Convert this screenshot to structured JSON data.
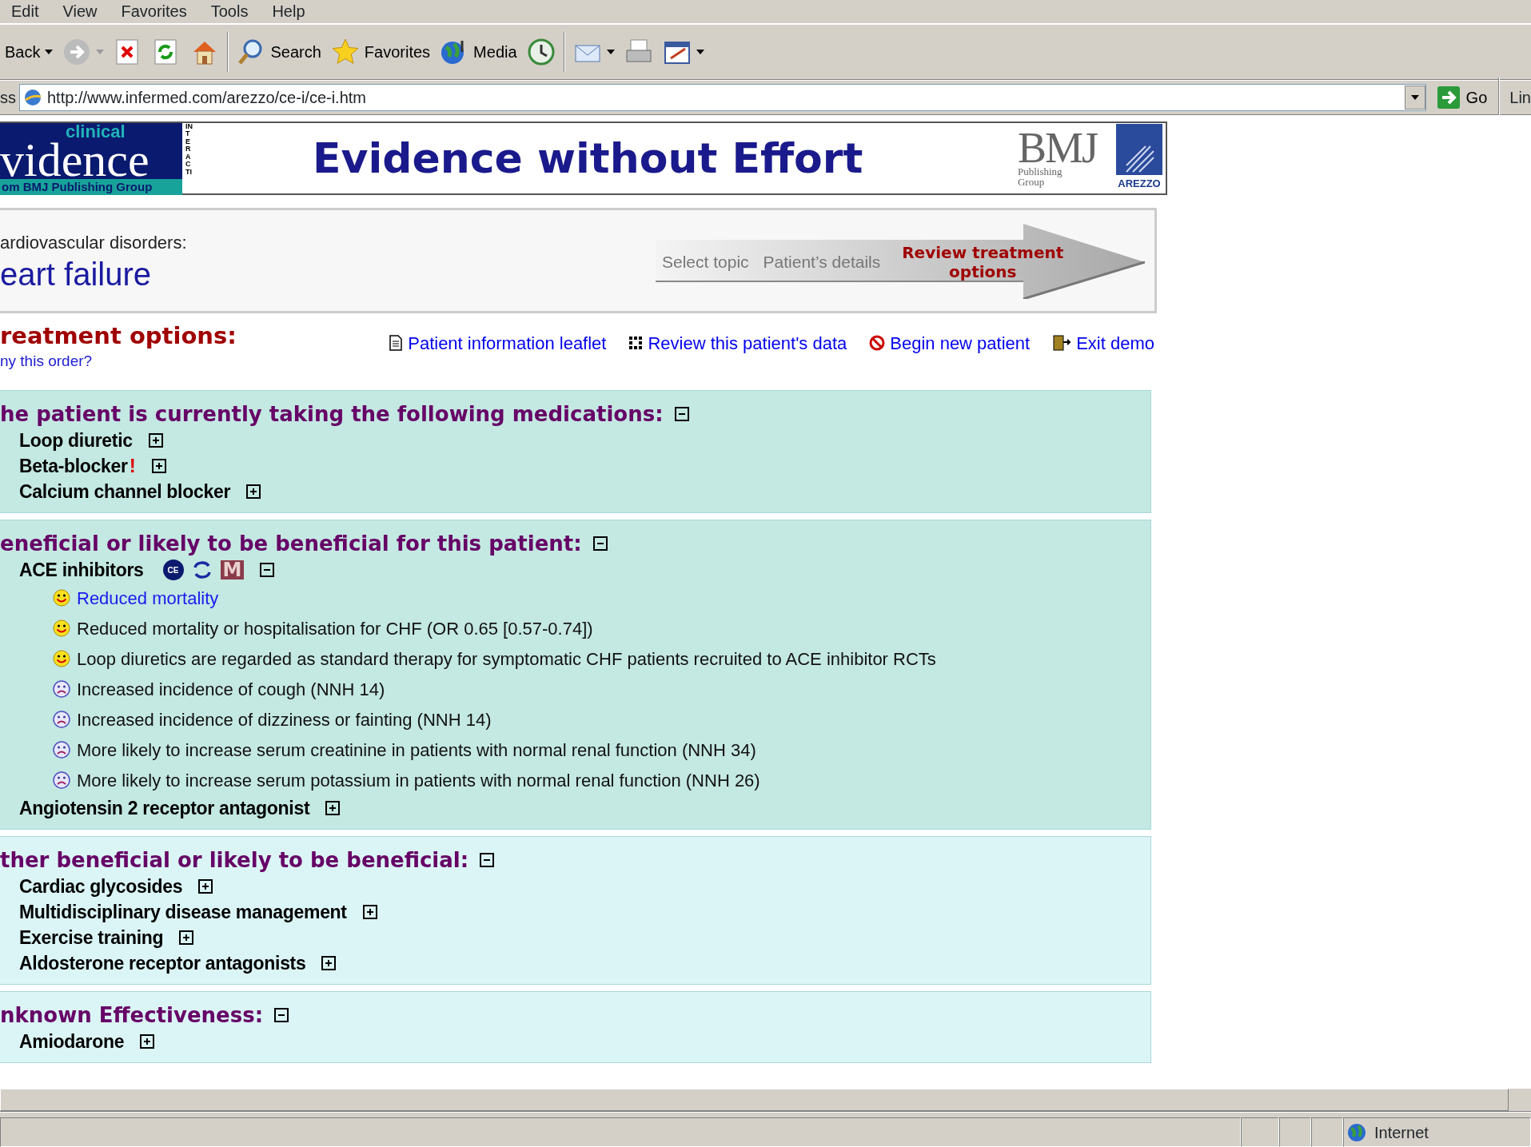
{
  "menu": [
    "Edit",
    "View",
    "Favorites",
    "Tools",
    "Help"
  ],
  "toolbar": [
    {
      "kind": "back",
      "label": "Back",
      "dropdown": true,
      "disabled": false
    },
    {
      "kind": "forward",
      "dropdown": true,
      "disabled": true
    },
    {
      "kind": "stop"
    },
    {
      "kind": "refresh"
    },
    {
      "kind": "home"
    },
    {
      "kind": "search",
      "label": "Search"
    },
    {
      "kind": "favorites",
      "label": "Favorites"
    },
    {
      "kind": "media",
      "label": "Media"
    },
    {
      "kind": "history"
    },
    {
      "kind": "mail",
      "dropdown": true
    },
    {
      "kind": "print"
    },
    {
      "kind": "edit",
      "dropdown": true
    }
  ],
  "address": {
    "label": "ss",
    "url": "http://www.infermed.com/arezzo/ce-i/ce-i.htm",
    "go": "Go",
    "links": "Lin"
  },
  "banner": {
    "logo_top": "clinical",
    "logo_main": "vidence",
    "logo_sub": "om BMJ Publishing Group",
    "logo_side": "INTERACTI",
    "headline": "Evidence without Effort",
    "publisher": "BMJ",
    "publisher_sub": "Publishing Group",
    "partner": "AREZZO"
  },
  "topic": {
    "category": "ardiovascular disorders:",
    "title": "eart failure"
  },
  "steps": [
    {
      "label": "Select topic",
      "selected": false
    },
    {
      "label": "Patient’s details",
      "selected": false
    },
    {
      "label": "Review treatment options",
      "selected": true
    }
  ],
  "treatment": {
    "title": "reatment options:",
    "why": "ny this order?"
  },
  "actions": [
    {
      "kind": "leaflet",
      "label": "Patient information leaflet"
    },
    {
      "kind": "data",
      "label": "Review this patient's data"
    },
    {
      "kind": "new",
      "label": "Begin new patient"
    },
    {
      "kind": "exit",
      "label": "Exit demo"
    }
  ],
  "sections": [
    {
      "title": "he patient is currently taking the following medications:",
      "expanded": true,
      "color": "#c4e8e2",
      "items": [
        {
          "label": "Loop diuretic",
          "expanded": false
        },
        {
          "label": "Beta-blocker",
          "flag": "!",
          "expanded": false
        },
        {
          "label": "Calcium channel blocker",
          "expanded": false
        }
      ]
    },
    {
      "title": "eneficial or likely to be beneficial for this patient:",
      "expanded": true,
      "color": "#c4e8e2",
      "items": [
        {
          "label": "ACE inhibitors",
          "expanded": true,
          "badges": [
            {
              "kind": "ce",
              "label": "CE"
            },
            {
              "kind": "cycle"
            },
            {
              "kind": "letter",
              "label": "M"
            }
          ],
          "outcomes": [
            {
              "kind": "benefit",
              "text": "Reduced mortality",
              "link": true
            },
            {
              "kind": "benefit",
              "text": "Reduced mortality or hospitalisation for CHF (OR 0.65 [0.57-0.74])",
              "link": false
            },
            {
              "kind": "benefit",
              "text": "Loop diuretics are regarded as standard therapy for symptomatic CHF patients recruited to ACE inhibitor RCTs",
              "link": false
            },
            {
              "kind": "harm",
              "text": "Increased incidence of cough (NNH 14)",
              "link": false
            },
            {
              "kind": "harm",
              "text": "Increased incidence of dizziness or fainting (NNH 14)",
              "link": false
            },
            {
              "kind": "harm",
              "text": "More likely to increase serum creatinine in patients with normal renal function (NNH 34)",
              "link": false
            },
            {
              "kind": "harm",
              "text": "More likely to increase serum potassium in patients with normal renal function (NNH 26)",
              "link": false
            }
          ]
        },
        {
          "label": "Angiotensin 2 receptor antagonist",
          "expanded": false
        }
      ]
    },
    {
      "title": "ther beneficial or likely to be beneficial:",
      "expanded": true,
      "color": "#dbf5f6",
      "items": [
        {
          "label": "Cardiac glycosides",
          "expanded": false
        },
        {
          "label": "Multidisciplinary disease management",
          "expanded": false
        },
        {
          "label": "Exercise training",
          "expanded": false
        },
        {
          "label": "Aldosterone receptor antagonists",
          "expanded": false
        }
      ]
    },
    {
      "title": "nknown Effectiveness:",
      "expanded": true,
      "color": "#dbf5f6",
      "items": [
        {
          "label": "Amiodarone",
          "expanded": false
        }
      ]
    }
  ],
  "status": {
    "zone": "Internet"
  }
}
